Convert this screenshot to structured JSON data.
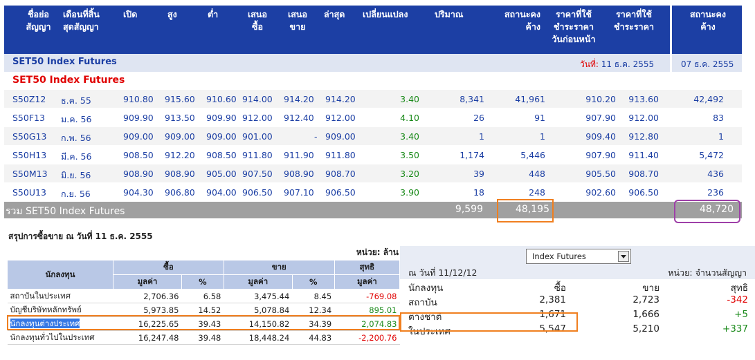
{
  "futures": {
    "headers": [
      "ชื่อย่อ\nสัญญา",
      "เดือนที่สิ้น\nสุดสัญญา",
      "เปิด",
      "สูง",
      "ต่ำ",
      "เสนอ\nซื้อ",
      "เสนอ\nขาย",
      "ล่าสุด",
      "เปลี่ยนแปลง",
      "ปริมาณ",
      "สถานะคง\nค้าง",
      "ราคาที่ใช้\nชำระราคา\nวันก่อนหน้า",
      "ราคาที่ใช้\nชำระราคา",
      "สถานะคง\nค้าง"
    ],
    "segment_title": "SET50 Index Futures",
    "date_label": "วันที่: ",
    "date_value": "11 ธ.ค. 2555",
    "prev_date": "07 ธ.ค. 2555",
    "subtitle": "SET50 Index Futures",
    "rows": [
      [
        "S50Z12",
        "ธ.ค. 55",
        "910.80",
        "915.60",
        "910.60",
        "914.00",
        "914.20",
        "914.20",
        "3.40",
        "8,341",
        "41,961",
        "910.20",
        "913.60",
        "42,492"
      ],
      [
        "S50F13",
        "ม.ค. 56",
        "909.90",
        "913.50",
        "909.90",
        "912.00",
        "912.40",
        "912.00",
        "4.10",
        "26",
        "91",
        "907.90",
        "912.00",
        "83"
      ],
      [
        "S50G13",
        "ก.พ. 56",
        "909.00",
        "909.00",
        "909.00",
        "901.00",
        "-",
        "909.00",
        "3.40",
        "1",
        "1",
        "909.40",
        "912.80",
        "1"
      ],
      [
        "S50H13",
        "มี.ค. 56",
        "908.50",
        "912.20",
        "908.50",
        "911.80",
        "911.90",
        "911.80",
        "3.50",
        "1,174",
        "5,446",
        "907.90",
        "911.40",
        "5,472"
      ],
      [
        "S50M13",
        "มิ.ย. 56",
        "908.90",
        "908.90",
        "905.00",
        "907.50",
        "908.90",
        "908.70",
        "3.20",
        "39",
        "448",
        "905.50",
        "908.70",
        "436"
      ],
      [
        "S50U13",
        "ก.ย. 56",
        "904.30",
        "906.80",
        "904.00",
        "906.50",
        "907.10",
        "906.50",
        "3.90",
        "18",
        "248",
        "902.60",
        "906.50",
        "236"
      ]
    ],
    "total": {
      "label": "รวม SET50 Index Futures",
      "volume": "9,599",
      "oi": "48,195",
      "prev_oi": "48,720"
    }
  },
  "summary": {
    "caption": "สรุปการซื้อขาย ณ วันที่ 11 ธ.ค. 2555",
    "unit": "หน่วย: ล้าน",
    "h_investor": "นักลงทุน",
    "h_buy": "ซื้อ",
    "h_sell": "ขาย",
    "h_net": "สุทธิ",
    "h_value": "มูลค่า",
    "h_pct": "%",
    "rows": [
      {
        "name": "สถาบันในประเทศ",
        "buy": "2,706.36",
        "buy_pct": "6.58",
        "sell": "3,475.44",
        "sell_pct": "8.45",
        "net": "-769.08",
        "sign": "neg"
      },
      {
        "name": "บัญชีบริษัทหลักทรัพย์",
        "buy": "5,973.85",
        "buy_pct": "14.52",
        "sell": "5,078.84",
        "sell_pct": "12.34",
        "net": "895.01",
        "sign": "pos"
      },
      {
        "name": "นักลงทุนต่างประเทศ",
        "buy": "16,225.65",
        "buy_pct": "39.43",
        "sell": "14,150.82",
        "sell_pct": "34.39",
        "net": "2,074.83",
        "sign": "pos"
      },
      {
        "name": "นักลงทุนทั่วไปในประเทศ",
        "buy": "16,247.48",
        "buy_pct": "39.48",
        "sell": "18,448.24",
        "sell_pct": "44.83",
        "net": "-2,200.76",
        "sign": "neg"
      }
    ]
  },
  "panel": {
    "dropdown": "Index Futures",
    "date": "ณ วันที่ 11/12/12",
    "unit": "หน่วย: จำนวนสัญญา",
    "h_investor": "นักลงทุน",
    "h_buy": "ซื้อ",
    "h_sell": "ขาย",
    "h_net": "สุทธิ",
    "rows": [
      {
        "name": "สถาบัน",
        "buy": "2,381",
        "sell": "2,723",
        "net": "-342",
        "sign": "neg"
      },
      {
        "name": "ต่างชาติ",
        "buy": "1,671",
        "sell": "1,666",
        "net": "+5",
        "sign": "pos"
      },
      {
        "name": "ในประเทศ",
        "buy": "5,547",
        "sell": "5,210",
        "net": "+337",
        "sign": "pos"
      }
    ]
  },
  "colors": {
    "header": "#1c3fa4",
    "highlight_orange": "#f07f1f",
    "highlight_purple": "#9e3fa8",
    "negative": "#e00000",
    "positive": "#1a8a1a"
  }
}
